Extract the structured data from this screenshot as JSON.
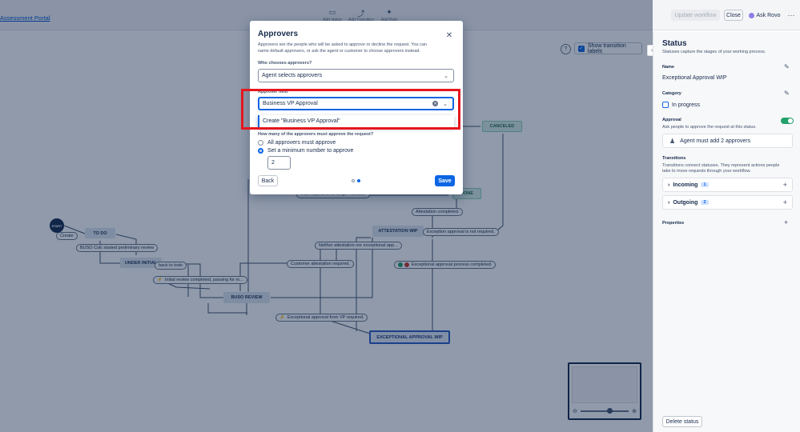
{
  "topbar": {
    "breadcrumb": "Assessment Portal",
    "tools": [
      {
        "label": "Add status",
        "icon": "status-icon"
      },
      {
        "label": "Add Transition",
        "icon": "transition-icon"
      },
      {
        "label": "Add Rule",
        "icon": "rule-icon"
      }
    ],
    "update_label": "Update workflow",
    "close_label": "Close",
    "rovo_label": "Ask Rovo",
    "more_label": "⋯"
  },
  "canvas": {
    "show_labels": "Show transition labels",
    "help": "?",
    "start_label": "START",
    "statuses": {
      "todo": "TO DO",
      "under_initial": "UNDER INITIAL",
      "buso_review": "BUSO REVIEW",
      "attestation_wip": "ATTESTATION WIP",
      "exceptional_wip": "EXCEPTIONAL APPROVAL WIP",
      "canceled": "CANCELED",
      "done": "DONE"
    },
    "transitions": {
      "create": "Create",
      "buso_started": "BUSO CoE started preliminary review",
      "back_todo": "back to todo",
      "initial_review": "Initial review completed, passing for m...",
      "customer_attest": "Customer attestation required.",
      "neither": "Neither attestation nor exceptional app...",
      "attest_completed": "Attestation completed.",
      "not_needed": "This request is no longer needed.",
      "exception_not_req": "Exception approval is not required.",
      "exc_completed": "Exceptional approval process completed.",
      "exc_from_vp": "Exceptional approval from VP required."
    }
  },
  "panel": {
    "title": "Status",
    "subtitle": "Statuses capture the stages of your working process.",
    "name_label": "Name",
    "name_value": "Exceptional Approval WIP",
    "category_label": "Category",
    "category_value": "In progress",
    "approval_label": "Approval",
    "approval_desc": "Ask people to approve the request at this status.",
    "approval_summary": "Agent must add 2 approvers",
    "transitions_label": "Transitions",
    "transitions_desc_1": "Transitions connect statuses. They represent actions people",
    "transitions_desc_2": "take to move requests through your workflow.",
    "incoming_label": "Incoming",
    "incoming_count": "1",
    "outgoing_label": "Outgoing",
    "outgoing_count": "2",
    "properties_label": "Properties",
    "delete_label": "Delete status"
  },
  "modal": {
    "title": "Approvers",
    "desc_1": "Approvers are the people who will be asked to approve or decline the request. You can",
    "desc_2": "name default approvers, or ask the agent or customer to choose approvers instead.",
    "who_label": "Who chooses approvers?",
    "who_value": "Agent selects approvers",
    "field_label": "Approver field",
    "field_value": "Business VP Approval",
    "create_option": "Create \"Business VP Approval\"",
    "howmany_label": "How many of the approvers must approve the request?",
    "option_all": "All approvers must approve",
    "option_min": "Set a minimum number to approve",
    "min_value": "2",
    "back_label": "Back",
    "save_label": "Save"
  },
  "colors": {
    "accent": "#0c66e4",
    "highlight": "#e5161d",
    "toggle_on": "#22a06b"
  }
}
